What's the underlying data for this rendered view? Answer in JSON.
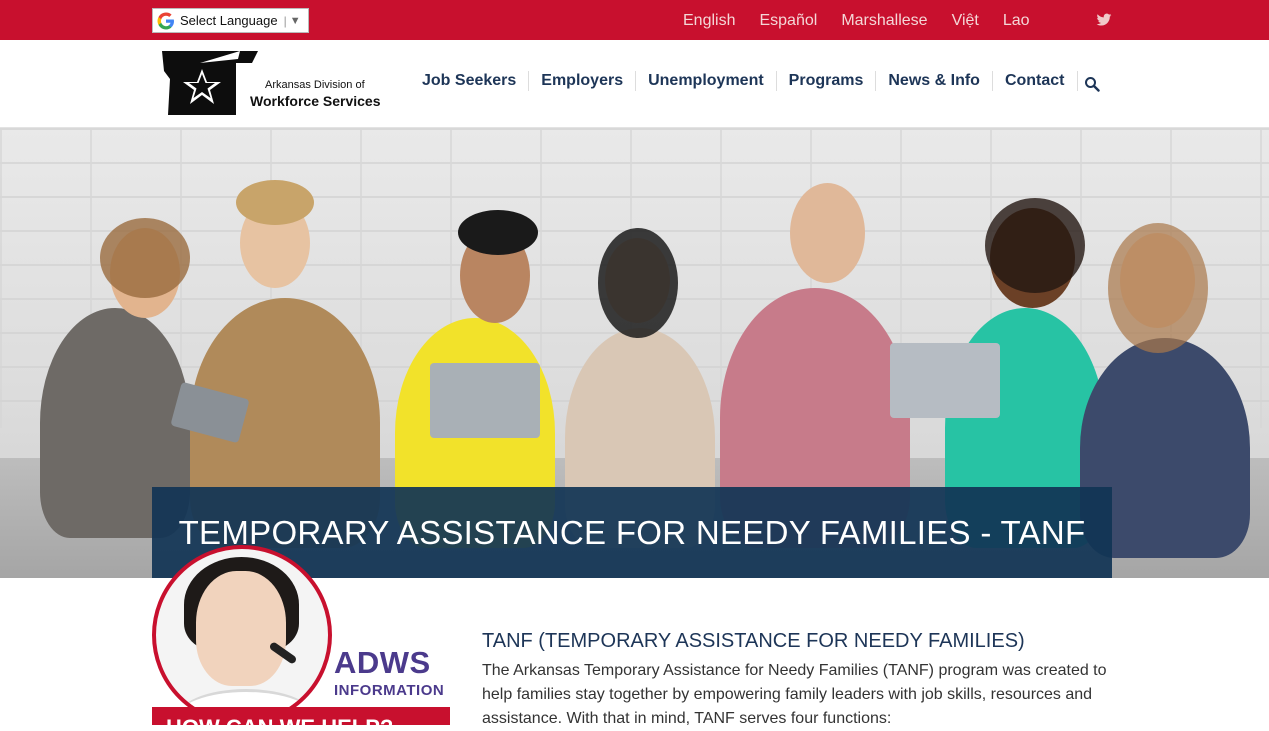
{
  "topbar": {
    "translate_label": "Select Language",
    "languages": [
      "English",
      "Español",
      "Marshallese",
      "Việt",
      "Lao"
    ],
    "social_icon": "twitter-icon",
    "bg_color": "#c8102e"
  },
  "logo": {
    "line1": "Arkansas Division of",
    "line2": "Workforce Services"
  },
  "nav": {
    "items": [
      "Job Seekers",
      "Employers",
      "Unemployment",
      "Programs",
      "News & Info",
      "Contact"
    ],
    "search_icon": "search-icon"
  },
  "hero": {
    "title": "TEMPORARY ASSISTANCE FOR NEEDY FAMILIES - TANF"
  },
  "promo": {
    "brand": "ADWS",
    "sub": "INFORMATION",
    "cta": "HOW CAN WE HELP?"
  },
  "article": {
    "heading": "TANF (TEMPORARY ASSISTANCE FOR NEEDY FAMILIES)",
    "body": "The Arkansas Temporary Assistance for Needy Families (TANF) program was created to help families stay together by empowering family leaders with job skills, resources and assistance. With that in mind, TANF serves four functions:"
  }
}
